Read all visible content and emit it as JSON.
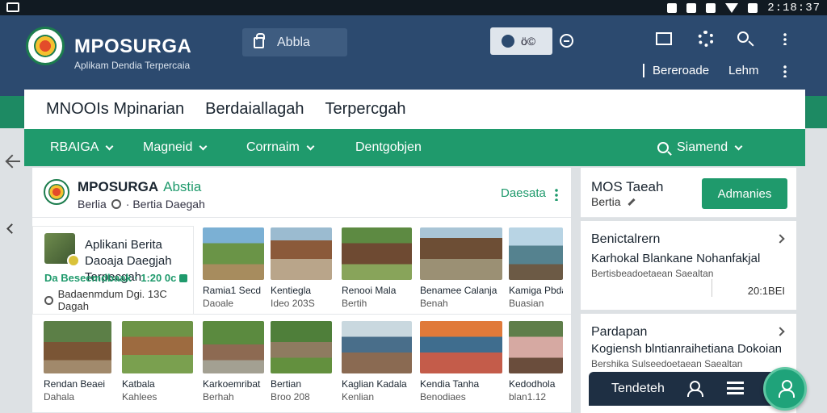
{
  "status_bar": {
    "time": "2:18:37"
  },
  "header": {
    "app_title": "MPOSURGA",
    "app_subtitle": "Aplikam Dendia Terpercaia",
    "search_label": "Abbla",
    "user_text": "ö©",
    "links": [
      "Bereroade",
      "Lehm"
    ]
  },
  "titlebar": {
    "items": [
      "MNOOIs Mpinarian",
      "Berdaiallagah",
      "Terpercgah"
    ]
  },
  "nav": {
    "items": [
      "RBAIGA",
      "Magneid",
      "Corrnaim",
      "Dentgobjen"
    ],
    "search_label": "Siamend"
  },
  "main": {
    "title": "MPOSURGA",
    "title_accent": "Abstia",
    "crumb_first": "Berlia",
    "crumb_second": "· Bertia Daegah",
    "action": "Daesata",
    "feature": {
      "title": "Aplikani Berita Daoaja Daegjah Terpecgah",
      "meta": "Da Beseemdbaak · 1:20 0c",
      "sub": "Badaenmdum Dgi. 13C Dagah"
    },
    "cards_row1": [
      {
        "caption": "Ramia1 Secd",
        "sub": "Daoale"
      },
      {
        "caption": "Kentiegla",
        "sub": "Ideo 203S"
      },
      {
        "caption": "Renooi Mala",
        "sub": "Bertih"
      },
      {
        "caption": "Benamee Calanja",
        "sub": "Benah"
      },
      {
        "caption": "Kamiga Pbda",
        "sub": "Buasian"
      }
    ],
    "cards_row2": [
      {
        "caption": "Rendan Beaei",
        "sub": "Dahala"
      },
      {
        "caption": "Katbala",
        "sub": "Kahlees"
      },
      {
        "caption": "Karkoemribat",
        "sub": "Berhah"
      },
      {
        "caption": "Kaglian Kadala",
        "sub": "Kenlian"
      },
      {
        "caption": "Kendia Tanha",
        "sub": "Benodiaes"
      },
      {
        "caption": "Kedodhola",
        "sub": "blan1.12"
      },
      {
        "caption": "Bertian",
        "sub": "Broo 208"
      }
    ]
  },
  "sidebar": {
    "top_title": "MOS Taeah",
    "top_sub": "Bertia",
    "top_button": "Admanies",
    "list1": {
      "heading": "Benictalrern",
      "line": "Karhokal Blankane Nohanfakjal",
      "sub": "Bertisbeadoetaean Saealtan",
      "number": "20:1BEI"
    },
    "list2": {
      "heading": "Pardapan",
      "line": "Kogiensh blntianraihetiana Dokoian",
      "sub": "Bershika Sulseedoetaean Saealtan"
    }
  },
  "bottom_bar": {
    "label": "Tendeteh"
  }
}
